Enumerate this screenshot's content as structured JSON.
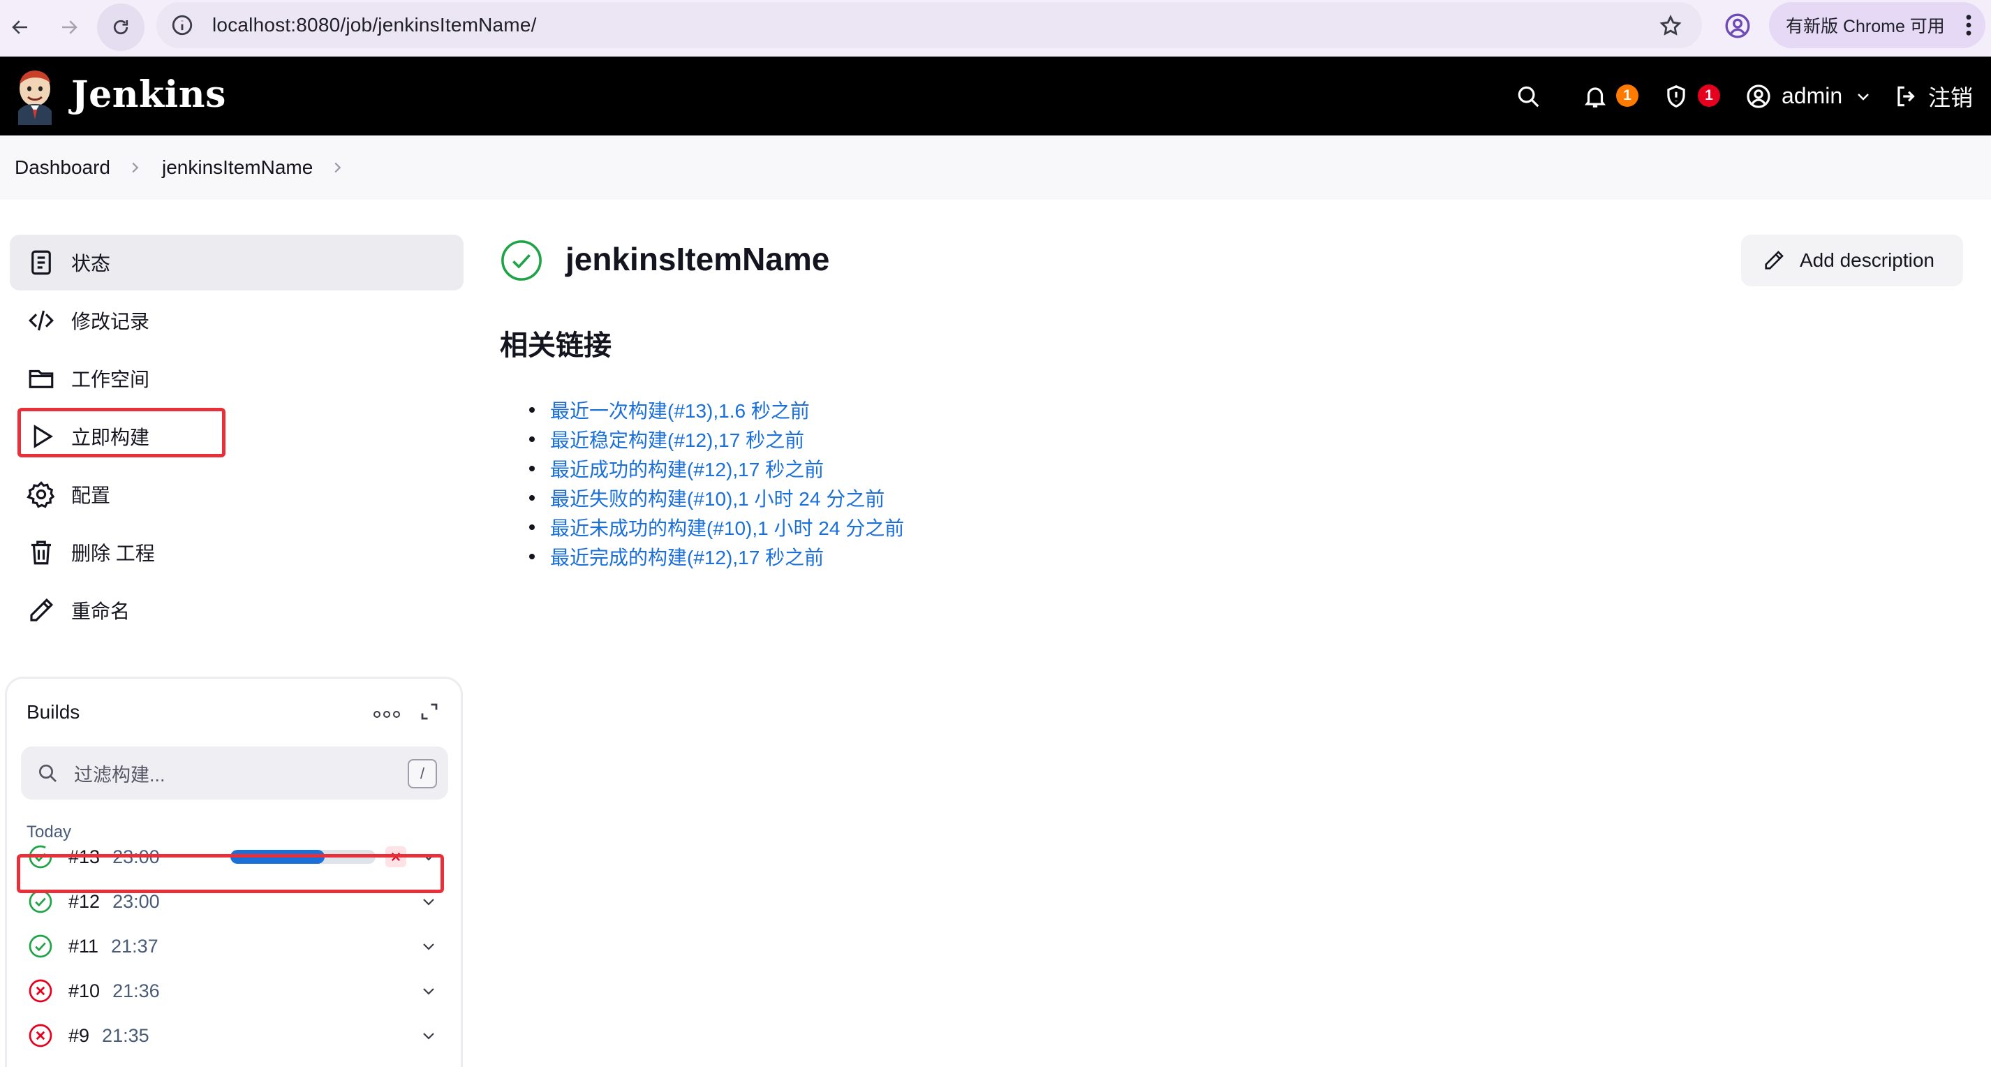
{
  "browser": {
    "url": "localhost:8080/job/jenkinsItemName/",
    "update_label": "有新版 Chrome 可用"
  },
  "header": {
    "brand": "Jenkins",
    "notifications_count": "1",
    "security_count": "1",
    "user": "admin",
    "logout": "注销"
  },
  "breadcrumb": [
    "Dashboard",
    "jenkinsItemName"
  ],
  "sidebar": {
    "tasks": [
      {
        "label": "状态",
        "icon": "status-icon"
      },
      {
        "label": "修改记录",
        "icon": "code-icon"
      },
      {
        "label": "工作空间",
        "icon": "folder-icon"
      },
      {
        "label": "立即构建",
        "icon": "play-icon"
      },
      {
        "label": "配置",
        "icon": "gear-icon"
      },
      {
        "label": "删除 工程",
        "icon": "trash-icon"
      },
      {
        "label": "重命名",
        "icon": "pencil-icon"
      }
    ]
  },
  "builds": {
    "title": "Builds",
    "filter_placeholder": "过滤构建...",
    "filter_shortcut": "/",
    "group_label": "Today",
    "items": [
      {
        "number": "#13",
        "time": "23:00",
        "status": "success",
        "in_progress": true,
        "progress": 0.65
      },
      {
        "number": "#12",
        "time": "23:00",
        "status": "success"
      },
      {
        "number": "#11",
        "time": "21:37",
        "status": "success"
      },
      {
        "number": "#10",
        "time": "21:36",
        "status": "failed"
      },
      {
        "number": "#9",
        "time": "21:35",
        "status": "failed"
      }
    ]
  },
  "main": {
    "job_name": "jenkinsItemName",
    "add_description": "Add description",
    "section_title": "相关链接",
    "links": [
      "最近一次构建(#13),1.6 秒之前",
      "最近稳定构建(#12),17 秒之前",
      "最近成功的构建(#12),17 秒之前",
      "最近失败的构建(#10),1 小时 24 分之前",
      "最近未成功的构建(#10),1 小时 24 分之前",
      "最近完成的构建(#12),17 秒之前"
    ]
  },
  "colors": {
    "success": "#1ea446",
    "failed": "#e6001f",
    "link": "#1a6fd8",
    "highlight": "#e8303b"
  }
}
